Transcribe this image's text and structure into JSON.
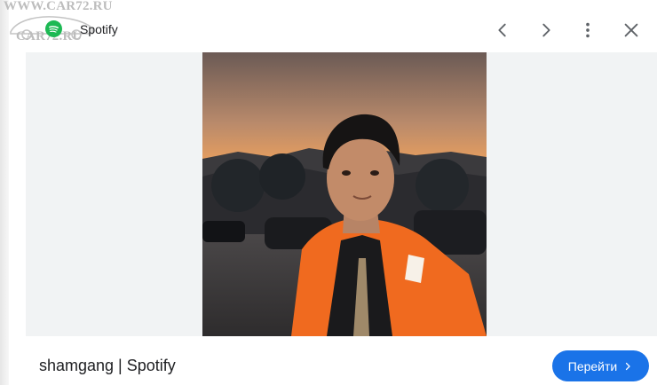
{
  "watermark": {
    "line1": "WWW.CAR72.RU",
    "line2": "CAR72.RU"
  },
  "header": {
    "source_title": "Spotify",
    "source_icon": "spotify-icon",
    "buttons": {
      "prev_icon": "chevron-left-icon",
      "next_icon": "chevron-right-icon",
      "more_icon": "more-vert-icon",
      "close_icon": "close-icon"
    }
  },
  "media": {
    "image_subject": "portrait of a man in an orange jacket at sunset"
  },
  "footer": {
    "caption": "shamgang | Spotify",
    "go_label": "Перейти"
  },
  "colors": {
    "accent": "#1a73e8",
    "spotify_green": "#1db954",
    "panel_bg": "#f1f3f4"
  }
}
